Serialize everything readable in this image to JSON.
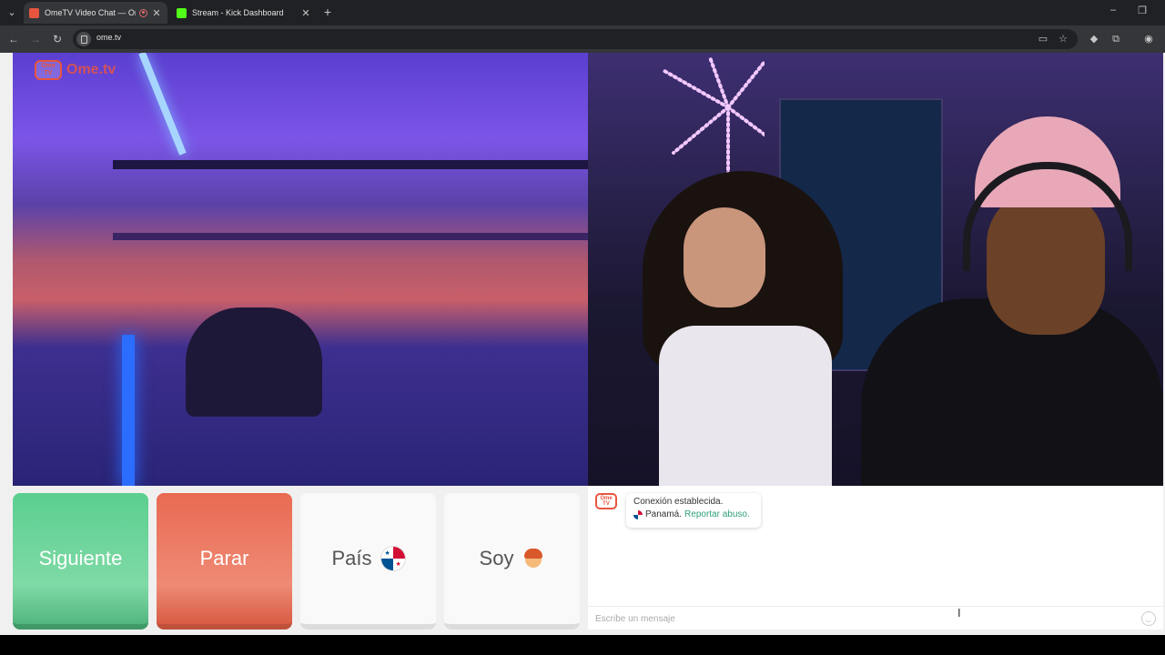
{
  "browser": {
    "tabs": [
      {
        "title": "OmeTV Video Chat — Ome",
        "active": true
      },
      {
        "title": "Stream - Kick Dashboard",
        "active": false
      }
    ],
    "url": "ome.tv"
  },
  "logo": {
    "badge": "Ome TV",
    "text": "Ome.tv"
  },
  "controls": {
    "next_label": "Siguiente",
    "stop_label": "Parar",
    "country_label": "País",
    "gender_label": "Soy"
  },
  "chat": {
    "system_message_line1": "Conexión establecida.",
    "country": "Panamá.",
    "report_label": "Reportar abuso.",
    "input_placeholder": "Escribe un mensaje"
  },
  "colors": {
    "next": "#5bcf8f",
    "stop": "#e96a52",
    "brand": "#e8553f",
    "report_link": "#2e9e7a"
  }
}
